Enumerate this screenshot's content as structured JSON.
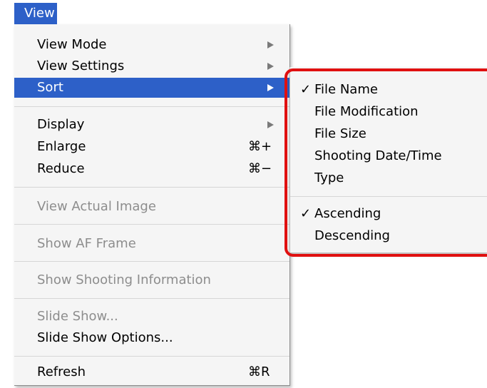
{
  "menubar": {
    "title": "View"
  },
  "menu": {
    "view_mode": {
      "label": "View Mode"
    },
    "view_settings": {
      "label": "View Settings"
    },
    "sort": {
      "label": "Sort"
    },
    "display": {
      "label": "Display"
    },
    "enlarge": {
      "label": "Enlarge",
      "shortcut": "⌘+"
    },
    "reduce": {
      "label": "Reduce",
      "shortcut": "⌘−"
    },
    "view_actual_image": {
      "label": "View Actual Image"
    },
    "show_af_frame": {
      "label": "Show AF Frame"
    },
    "show_shooting_information": {
      "label": "Show Shooting Information"
    },
    "slide_show": {
      "label": "Slide Show..."
    },
    "slide_show_options": {
      "label": "Slide Show Options..."
    },
    "refresh": {
      "label": "Refresh",
      "shortcut": "⌘R"
    }
  },
  "submenu": {
    "check_mark": "✓",
    "file_name": {
      "label": "File Name",
      "checked": true
    },
    "file_modification": {
      "label": "File Modification",
      "checked": false
    },
    "file_size": {
      "label": "File Size",
      "checked": false
    },
    "shooting_date_time": {
      "label": "Shooting Date/Time",
      "checked": false
    },
    "type": {
      "label": "Type",
      "checked": false
    },
    "ascending": {
      "label": "Ascending",
      "checked": true
    },
    "descending": {
      "label": "Descending",
      "checked": false
    }
  },
  "colors": {
    "selection": "#2d60c8",
    "disabled_text": "#8d8d8d",
    "highlight_box": "#e01010",
    "menu_background": "#f5f5f5"
  }
}
